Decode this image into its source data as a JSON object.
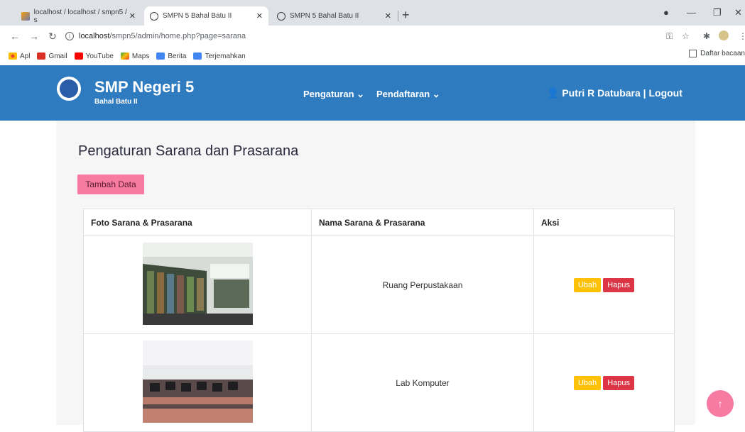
{
  "browser": {
    "tabs": [
      {
        "title": "localhost / localhost / smpn5 / s"
      },
      {
        "title": "SMPN 5 Bahal Batu II"
      },
      {
        "title": "SMPN 5 Bahal Batu II"
      }
    ],
    "new_tab": "+",
    "url_host": "localhost",
    "url_path": "/smpn5/admin/home.php?page=sarana",
    "bookmarks": [
      {
        "label": "Apl",
        "color": "#ea4335"
      },
      {
        "label": "Gmail",
        "color": "#d93025"
      },
      {
        "label": "YouTube",
        "color": "#ff0000"
      },
      {
        "label": "Maps",
        "color": "#34a853"
      },
      {
        "label": "Berita",
        "color": "#4285f4"
      },
      {
        "label": "Terjemahkan",
        "color": "#4285f4"
      }
    ],
    "reading_list": "Daftar bacaan"
  },
  "site": {
    "brand": "SMP Negeri 5",
    "brand_sub": "Bahal Batu II",
    "menu": [
      {
        "label": "Pengaturan ⌄"
      },
      {
        "label": "Pendaftaran ⌄"
      }
    ],
    "user": "👤 Putri R Datubara  | Logout",
    "accent": "#2e7bc0"
  },
  "page": {
    "title": "Pengaturan Sarana dan Prasarana",
    "add_button": "Tambah Data",
    "columns": [
      "Foto Sarana & Prasarana",
      "Nama Sarana & Prasarana",
      "Aksi"
    ],
    "rows": [
      {
        "name": "Ruang Perpustakaan",
        "edit": "Ubah",
        "delete": "Hapus"
      },
      {
        "name": "Lab Komputer",
        "edit": "Ubah",
        "delete": "Hapus"
      }
    ]
  }
}
